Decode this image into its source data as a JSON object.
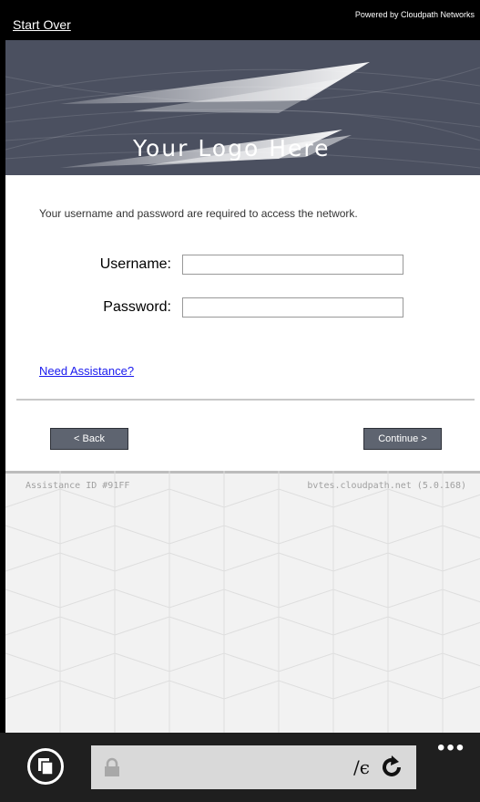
{
  "header": {
    "start_over": "Start Over",
    "powered_by": "Powered by Cloudpath Networks"
  },
  "banner": {
    "logo_text": "Your Logo Here"
  },
  "form": {
    "intro": "Your username and password are required to access the network.",
    "username_label": "Username:",
    "username_value": "",
    "password_label": "Password:",
    "password_value": "",
    "assist_link": "Need Assistance?",
    "back_button": "< Back",
    "continue_button": "Continue >"
  },
  "footer": {
    "assistance_id": "Assistance ID #91FF",
    "server": "bvtes.cloudpath.net (5.0.168)"
  },
  "browser": {
    "address_text": "/ϵ",
    "icons": [
      "tabs-icon",
      "lock-icon",
      "refresh-icon",
      "more-icon"
    ]
  },
  "colors": {
    "banner_bg": "#4b5060",
    "button_bg": "#5e6470",
    "link": "#1a1aee",
    "appbar": "#1f1f1f"
  }
}
